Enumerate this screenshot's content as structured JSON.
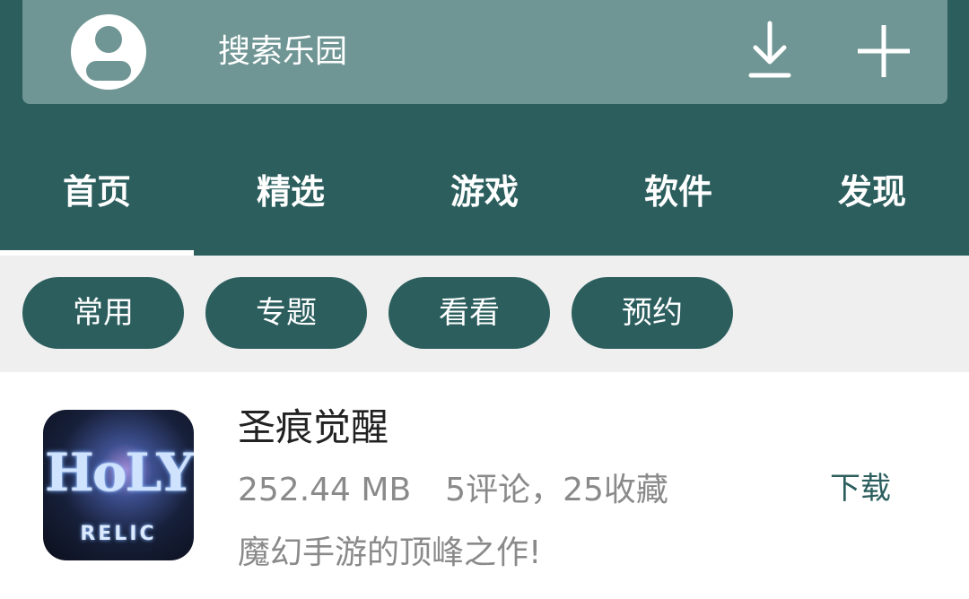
{
  "search": {
    "placeholder": "搜索乐园"
  },
  "icons": {
    "avatar": "user-avatar-icon",
    "download": "download-icon",
    "add": "plus-icon"
  },
  "tabs": [
    {
      "label": "首页",
      "active": true
    },
    {
      "label": "精选"
    },
    {
      "label": "游戏"
    },
    {
      "label": "软件"
    },
    {
      "label": "发现"
    }
  ],
  "chips": [
    {
      "label": "常用"
    },
    {
      "label": "专题"
    },
    {
      "label": "看看"
    },
    {
      "label": "预约"
    }
  ],
  "app": {
    "name": "圣痕觉醒",
    "size": "252.44 MB",
    "stats": "5评论，25收藏",
    "description": "魔幻手游的顶峰之作!",
    "action": "下载",
    "logo_main": "HoLY",
    "logo_sub": "RELIC"
  },
  "colors": {
    "primary": "#2c5e5e",
    "search_bg": "#6f9694",
    "chip_row_bg": "#efefef"
  }
}
